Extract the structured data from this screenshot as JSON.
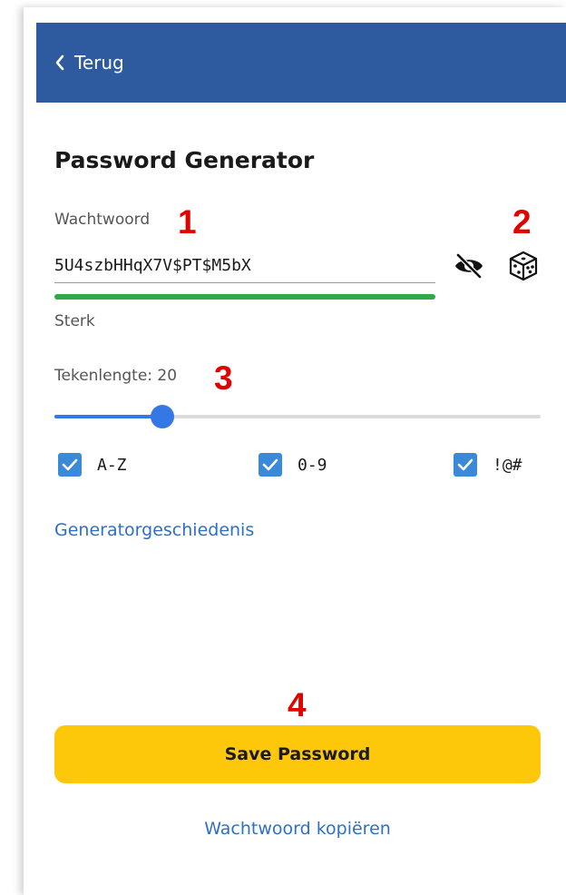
{
  "header": {
    "back_label": "Terug",
    "bg_color": "#2e5b9f"
  },
  "page": {
    "title": "Password Generator"
  },
  "password": {
    "label": "Wachtwoord",
    "value": "5U4szbHHqX7V$PT$M5bX",
    "strength_label": "Sterk",
    "strength_fraction": 1.0,
    "strength_color": "#2eaa4a",
    "visibility_icon": "eye-slash-icon",
    "generate_icon": "dice-icon"
  },
  "length": {
    "label": "Tekenlengte: 20",
    "value": 20,
    "min": 8,
    "max": 64,
    "fill_color": "#3578e5"
  },
  "options": [
    {
      "label": "A-Z",
      "checked": true
    },
    {
      "label": "0-9",
      "checked": true
    },
    {
      "label": "!@#",
      "checked": true
    }
  ],
  "links": {
    "history": "Generatorgeschiedenis",
    "copy": "Wachtwoord kopiëren"
  },
  "save_button": {
    "label": "Save Password",
    "color": "#fdc80a"
  },
  "markers": [
    "1",
    "2",
    "3",
    "4"
  ]
}
